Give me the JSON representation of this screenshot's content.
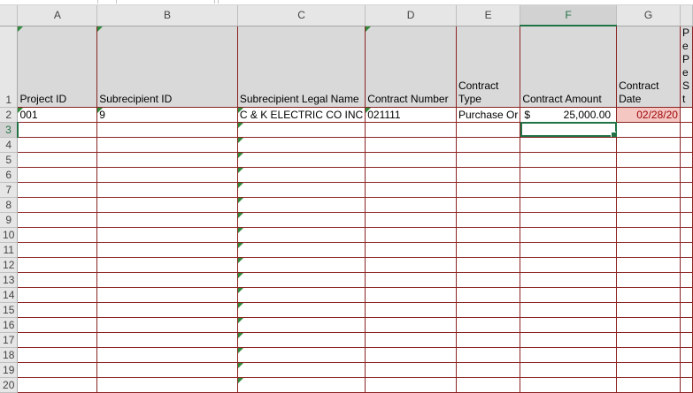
{
  "columns": [
    "A",
    "B",
    "C",
    "D",
    "E",
    "F",
    "G",
    ""
  ],
  "selected_column": "F",
  "selected_row": "3",
  "header_row": {
    "number": "1",
    "cells": [
      "Project ID",
      "Subrecipient ID",
      "Subrecipient Legal Name",
      "Contract Number",
      "Contract Type",
      "Contract Amount",
      "Contract Date",
      "Pe Pe St"
    ]
  },
  "data_row": {
    "number": "2",
    "project_id": "001",
    "subrecipient_id": "9",
    "legal_name": "C & K ELECTRIC CO INC",
    "contract_number": "021111",
    "contract_type": "Purchase Or",
    "amount_symbol": "$",
    "contract_amount": "25,000.00",
    "contract_date": "02/28/20"
  },
  "empty_rows": [
    "3",
    "4",
    "5",
    "6",
    "7",
    "8",
    "9",
    "10",
    "11",
    "12",
    "13",
    "14",
    "15",
    "16",
    "17",
    "18",
    "19",
    "20"
  ],
  "colors": {
    "excel_green": "#217346",
    "border_red": "#8b2323",
    "highlight_pink": "#f4c7c3"
  }
}
